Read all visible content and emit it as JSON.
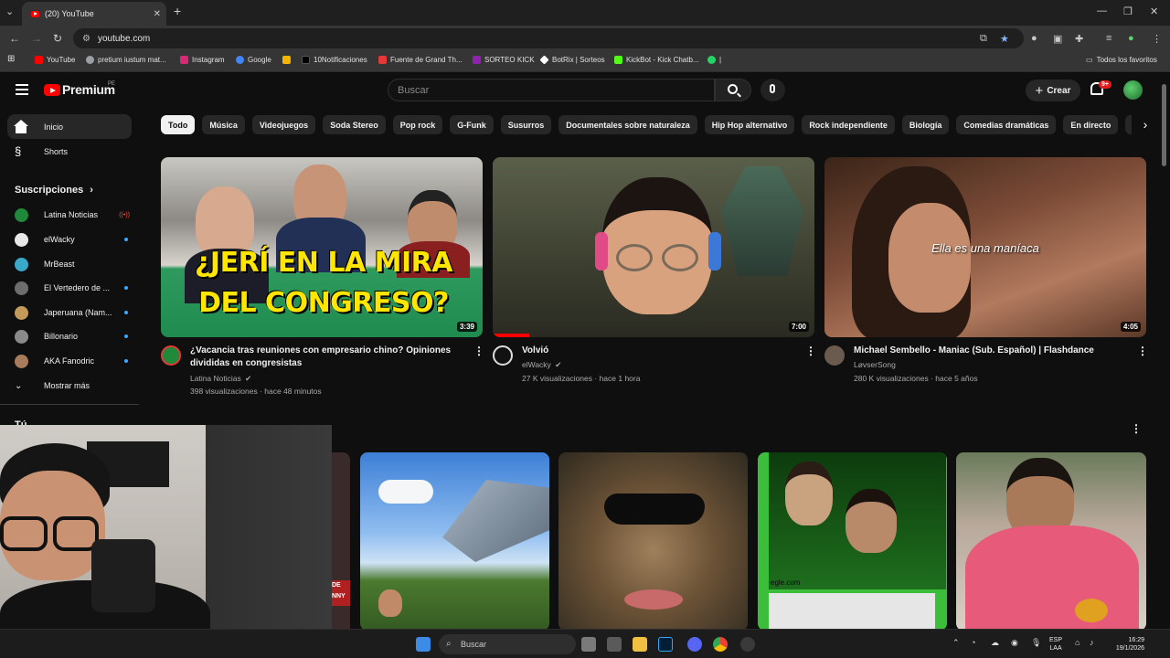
{
  "browser": {
    "tab_title": "(20) YouTube",
    "url": "youtube.com",
    "bookmarks": [
      {
        "label": "YouTube",
        "color": "#ff0000"
      },
      {
        "label": "pretium iustum mat...",
        "color": "#9aa0a6"
      },
      {
        "label": "Instagram",
        "color": "#d62976"
      },
      {
        "label": "Google",
        "color": "#4285f4"
      },
      {
        "label": "",
        "color": "#f4b400"
      },
      {
        "label": "10Notificaciones",
        "color": "#000000"
      },
      {
        "label": "Fuente de Grand Th...",
        "color": "#e53935"
      },
      {
        "label": "SORTEO KICK",
        "color": "#8e24aa"
      },
      {
        "label": "BotRix | Sorteos",
        "color": "#ffffff"
      },
      {
        "label": "KickBot - Kick Chatb...",
        "color": "#53fc18"
      },
      {
        "label": "|",
        "color": "#25d366"
      }
    ],
    "all_bookmarks": "Todos los favoritos"
  },
  "header": {
    "brand": "Premium",
    "region": "PE",
    "search_placeholder": "Buscar",
    "create_label": "Crear",
    "notif_badge": "9+"
  },
  "sidebar": {
    "items": [
      {
        "label": "Inicio"
      },
      {
        "label": "Shorts"
      }
    ],
    "subscriptions_title": "Suscripciones",
    "subscriptions": [
      {
        "name": "Latina Noticias",
        "status": "live",
        "color": "#1f8a3a"
      },
      {
        "name": "elWacky",
        "status": "new",
        "color": "#e8e8e8"
      },
      {
        "name": "MrBeast",
        "status": "",
        "color": "#3ba9c9"
      },
      {
        "name": "El Vertedero de ...",
        "status": "new",
        "color": "#6d6d6d"
      },
      {
        "name": "Japeruana (Nam...",
        "status": "new",
        "color": "#c49a58"
      },
      {
        "name": "Billonario",
        "status": "new",
        "color": "#8a8a8a"
      },
      {
        "name": "AKA Fanodric",
        "status": "new",
        "color": "#a87b5a"
      }
    ],
    "show_more": "Mostrar más",
    "you_section": "Tú"
  },
  "chips": [
    "Todo",
    "Música",
    "Videojuegos",
    "Soda Stereo",
    "Pop rock",
    "G-Funk",
    "Susurros",
    "Documentales sobre naturaleza",
    "Hip Hop alternativo",
    "Rock independiente",
    "Biología",
    "Comedias dramáticas",
    "En directo",
    "Historia"
  ],
  "videos": [
    {
      "title_line1": "¿Vacancia tras reuniones con empresario chino? Opiniones",
      "title_line2": "divididas en congresistas",
      "channel": "Latina Noticias",
      "meta": "398 visualizaciones · hace 48 minutos",
      "duration": "3:39",
      "thumb_text_1": "¿JERÍ EN LA MIRA",
      "thumb_text_2": "DEL CONGRESO?"
    },
    {
      "title_line1": "Volvió",
      "title_line2": "",
      "channel": "elWacky",
      "meta": "27 K visualizaciones · hace 1 hora",
      "duration": "7:00"
    },
    {
      "title_line1": "Michael Sembello - Maniac (Sub. Español) | Flashdance",
      "title_line2": "",
      "channel": "LøvserSong",
      "meta": "280 K visualizaciones · hace 5 años",
      "duration": "4:05",
      "thumb_subtitle": "Ella es una maníaca"
    }
  ],
  "shorts_row_partial_text": "DE NNY",
  "shorts_thumb_text": "egle.com",
  "taskbar": {
    "search": "Buscar",
    "lang_1": "ESP",
    "lang_2": "LAA",
    "time": "16:29",
    "date": "19/1/2026"
  }
}
